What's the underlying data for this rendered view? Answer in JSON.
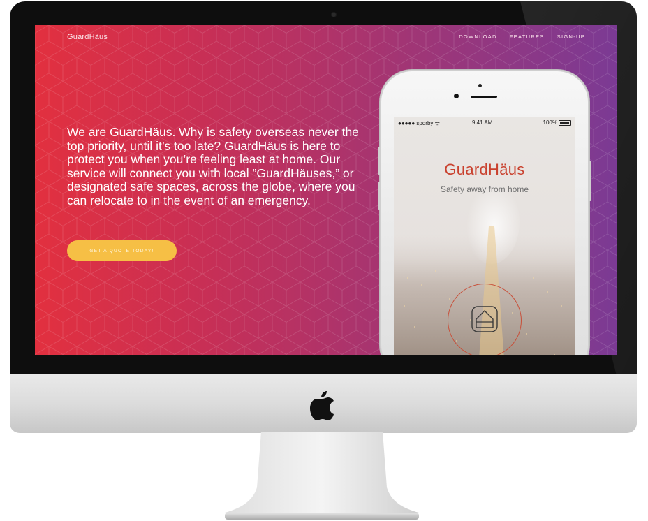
{
  "site": {
    "brand": "GuardHäus",
    "nav": [
      "DOWNLOAD",
      "FEATURES",
      "SIGN-UP"
    ],
    "intro": "We are GuardHäus. Why is safety overseas never the top priority, until it’s too late? GuardHäus is here to protect you when you’re feeling least at home. Our service will connect you with local ”GuardHäuses,” or designated safe spaces, across the globe, where you can relocate to in the event of an emergency.",
    "cta": "GET A QUOTE TODAY!"
  },
  "phone": {
    "status": {
      "carrier": "●●●●● spdrby ᯤ",
      "time": "9:41 AM",
      "battery": "100%"
    },
    "app_title": "GuardHäus",
    "tagline": "Safety away from home"
  },
  "colors": {
    "gradient_start": "#e2303f",
    "gradient_end": "#7b3a94",
    "cta": "#f6bf45",
    "app_accent": "#c9412e"
  },
  "icons": [
    "apple-logo-icon",
    "home-icon",
    "wifi-icon",
    "battery-icon"
  ]
}
